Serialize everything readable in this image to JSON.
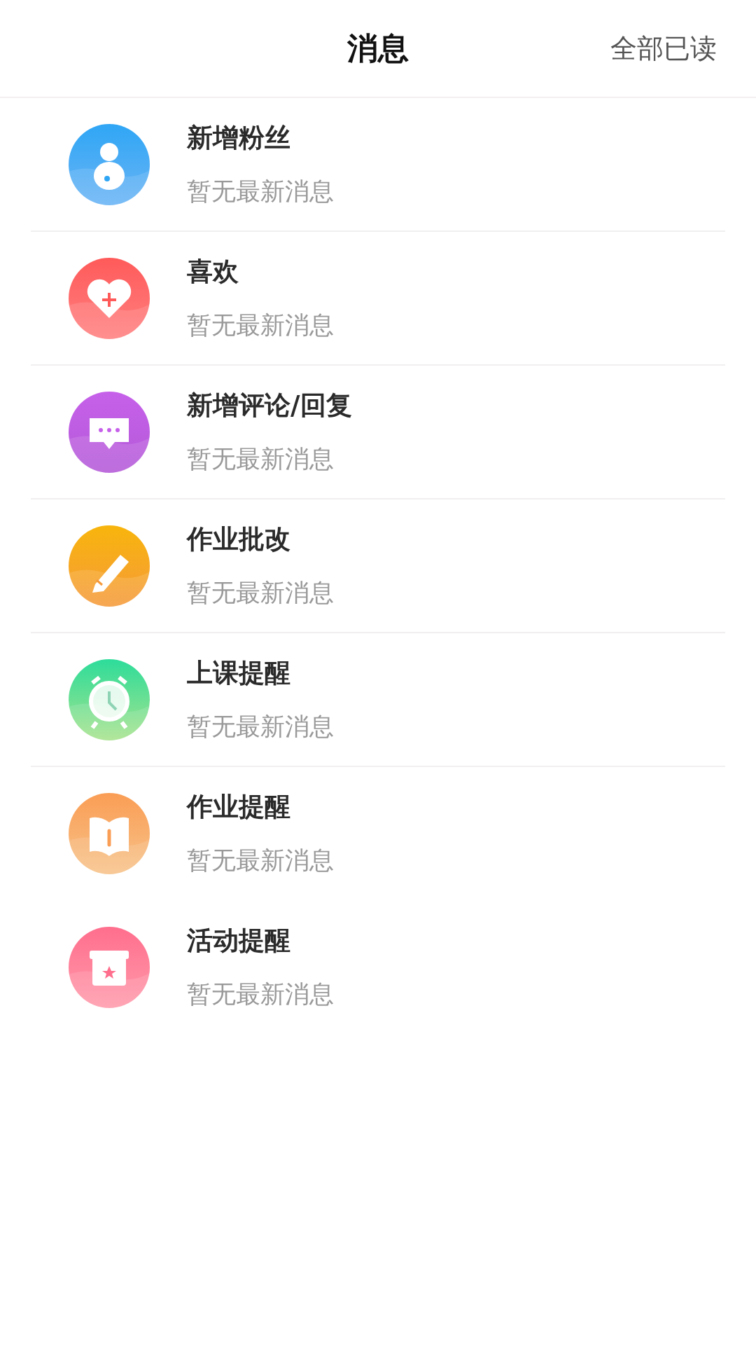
{
  "header": {
    "title": "消息",
    "action": "全部已读"
  },
  "items": [
    {
      "kind": "fans",
      "title": "新增粉丝",
      "subtitle": "暂无最新消息",
      "divider": true
    },
    {
      "kind": "like",
      "title": "喜欢",
      "subtitle": "暂无最新消息",
      "divider": true
    },
    {
      "kind": "comment",
      "title": "新增评论/回复",
      "subtitle": "暂无最新消息",
      "divider": true
    },
    {
      "kind": "grading",
      "title": "作业批改",
      "subtitle": "暂无最新消息",
      "divider": true
    },
    {
      "kind": "class",
      "title": "上课提醒",
      "subtitle": "暂无最新消息",
      "divider": true
    },
    {
      "kind": "homework",
      "title": "作业提醒",
      "subtitle": "暂无最新消息",
      "divider": false
    },
    {
      "kind": "activity",
      "title": "活动提醒",
      "subtitle": "暂无最新消息",
      "divider": false
    }
  ]
}
